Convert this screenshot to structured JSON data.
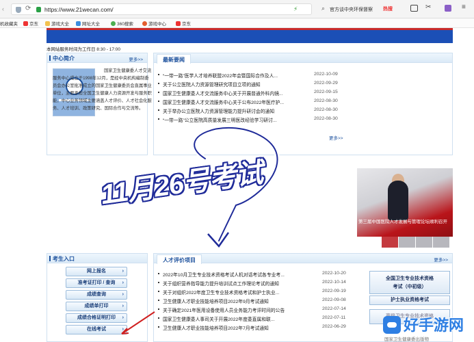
{
  "browser": {
    "url": "https://www.21wecan.com/",
    "search_text": "官方谈中央环保督察",
    "hot_label": "热搜",
    "bookmarks": [
      "机收藏夹",
      "京东",
      "游戏大全",
      "网址大全",
      "360搜索",
      "游戏中心",
      "京东"
    ]
  },
  "page": {
    "service_time": "本网站服务时间为工作日 8:30 - 17:00"
  },
  "intro": {
    "title": "中心简介",
    "more": "更多>>",
    "text": "国家卫生健康委人才交流服务中心成立于1998年12月，是经中央机构编制委员会办公室批准成立的国家卫生健康委员会直属事业单位，主要承担全国卫生健康人力资源开发与服务职能，中心业务领域主要涵盖人才评价、人才社会化服务、人才培训、政策研究、国际合作与交流等。"
  },
  "news": {
    "title": "最新要闻",
    "more": "更多>>",
    "items": [
      {
        "title": "“一带一路”医学人才培养联盟2022年会暨国际合作及人...",
        "date": "2022-10-09"
      },
      {
        "title": "关于公立医院人力资源管理研究项目立项的通知",
        "date": "2022-09-29"
      },
      {
        "title": "国家卫生健康委人才交流服务中心关于开展普通外科内镜...",
        "date": "2022-09-15"
      },
      {
        "title": "国家卫生健康委人才交流服务中心关于公布2022年医疗护...",
        "date": "2022-08-30"
      },
      {
        "title": "关于举办公立医院人力资源管理能力提升研讨会的通知",
        "date": "2022-08-30"
      },
      {
        "title": "“一带一路”公立医院高质量发展三明医改经验学习研讨...",
        "date": "2022-08-30"
      }
    ]
  },
  "overlay": {
    "text": "11月26号考试"
  },
  "photo": {
    "caption": "第三届中国医院人才发展与管理论坛顺利召开"
  },
  "exam_entry": {
    "title": "考生入口",
    "buttons": [
      "网上报名",
      "准考证打印 / 查询",
      "成绩查询",
      "成绩单打印",
      "成绩合格证明打印",
      "在线考试"
    ]
  },
  "talent": {
    "title": "人才评价项目",
    "more": "更多>>",
    "items": [
      {
        "title": "2022年10月卫生专业技术资格考试人机对话考试各专业考...",
        "date": "2022-10-20"
      },
      {
        "title": "关于组织营养指导能力提升培训试点工作理论考试的通知",
        "date": "2022-10-14"
      },
      {
        "title": "关于对组织2022年度卫生专业技术资格考试和护士执业...",
        "date": "2022-09-19"
      },
      {
        "title": "卫生健康人才职业技能培养项目2022年9月考试通知",
        "date": "2022-09-08"
      },
      {
        "title": "关于确定2021年医用设备使用人员业务能力考评时间的公告",
        "date": "2022-07-14"
      },
      {
        "title": "国家卫生健康委人事司关于开展2022年度委直属和联...",
        "date": "2022-07-11"
      },
      {
        "title": "卫生健康人才职业技能培养项目2022年7月考试通知",
        "date": "2022-06-29"
      }
    ]
  },
  "right_buttons": {
    "b1_line1": "全国卫生专业技术资格",
    "b1_line2": "考试（中初级）",
    "b2": "护士执业资格考试",
    "b3": "高级卫生专业技术资格"
  },
  "watermark": {
    "text": "好手游网",
    "sub": "国家卫生健康委出版物"
  },
  "colors": {
    "brand_blue": "#1a4f9c",
    "header_blue": "#1b4fb6",
    "overlay_outline": "#1f2b99"
  }
}
